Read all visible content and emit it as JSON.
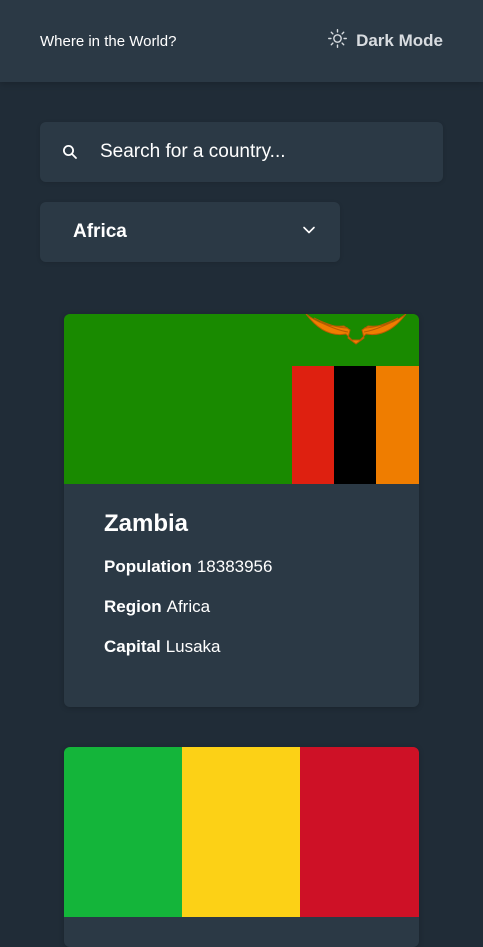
{
  "header": {
    "title": "Where in the World?",
    "mode_toggle_label": "Dark Mode"
  },
  "search": {
    "placeholder": "Search for a country..."
  },
  "filter": {
    "selected": "Africa"
  },
  "countries": [
    {
      "name": "Zambia",
      "stats": [
        {
          "label": "Population",
          "value": "18383956"
        },
        {
          "label": "Region",
          "value": "Africa"
        },
        {
          "label": "Capital",
          "value": "Lusaka"
        }
      ]
    },
    {
      "name": "",
      "stats": []
    }
  ],
  "colors": {
    "background": "#202c37",
    "surface": "#2b3945",
    "text": "#ffffff",
    "zambia_green": "#198a00",
    "zambia_red": "#de2010",
    "zambia_black": "#000000",
    "zambia_orange": "#ef7d00",
    "mali_green": "#14b53a",
    "mali_yellow": "#fcd116",
    "mali_red": "#ce1126"
  },
  "icons": {
    "mode_toggle": "sun-icon",
    "search": "search-icon",
    "filter": "chevron-down-icon"
  }
}
